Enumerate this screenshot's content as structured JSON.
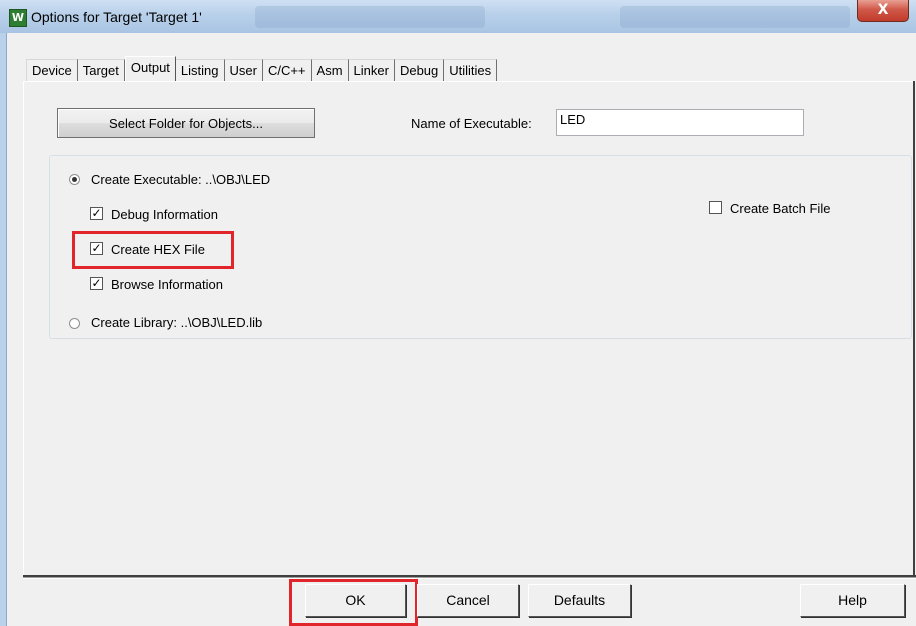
{
  "window": {
    "title": "Options for Target 'Target 1'",
    "icon_letter": "W",
    "close_label": "X"
  },
  "tabs": [
    {
      "label": "Device"
    },
    {
      "label": "Target"
    },
    {
      "label": "Output",
      "active": true
    },
    {
      "label": "Listing"
    },
    {
      "label": "User"
    },
    {
      "label": "C/C++"
    },
    {
      "label": "Asm"
    },
    {
      "label": "Linker"
    },
    {
      "label": "Debug"
    },
    {
      "label": "Utilities"
    }
  ],
  "output": {
    "select_folder_label": "Select Folder for Objects...",
    "name_of_executable_label": "Name of Executable:",
    "name_of_executable_value": "LED",
    "create_executable_label": "Create Executable:  ..\\OBJ\\LED",
    "debug_information_label": "Debug Information",
    "create_hex_file_label": "Create HEX File",
    "browse_information_label": "Browse Information",
    "create_library_label": "Create Library:  ..\\OBJ\\LED.lib",
    "create_batch_file_label": "Create Batch File"
  },
  "buttons": {
    "ok": "OK",
    "cancel": "Cancel",
    "defaults": "Defaults",
    "help": "Help"
  },
  "colors": {
    "highlight": "#e0262b"
  }
}
